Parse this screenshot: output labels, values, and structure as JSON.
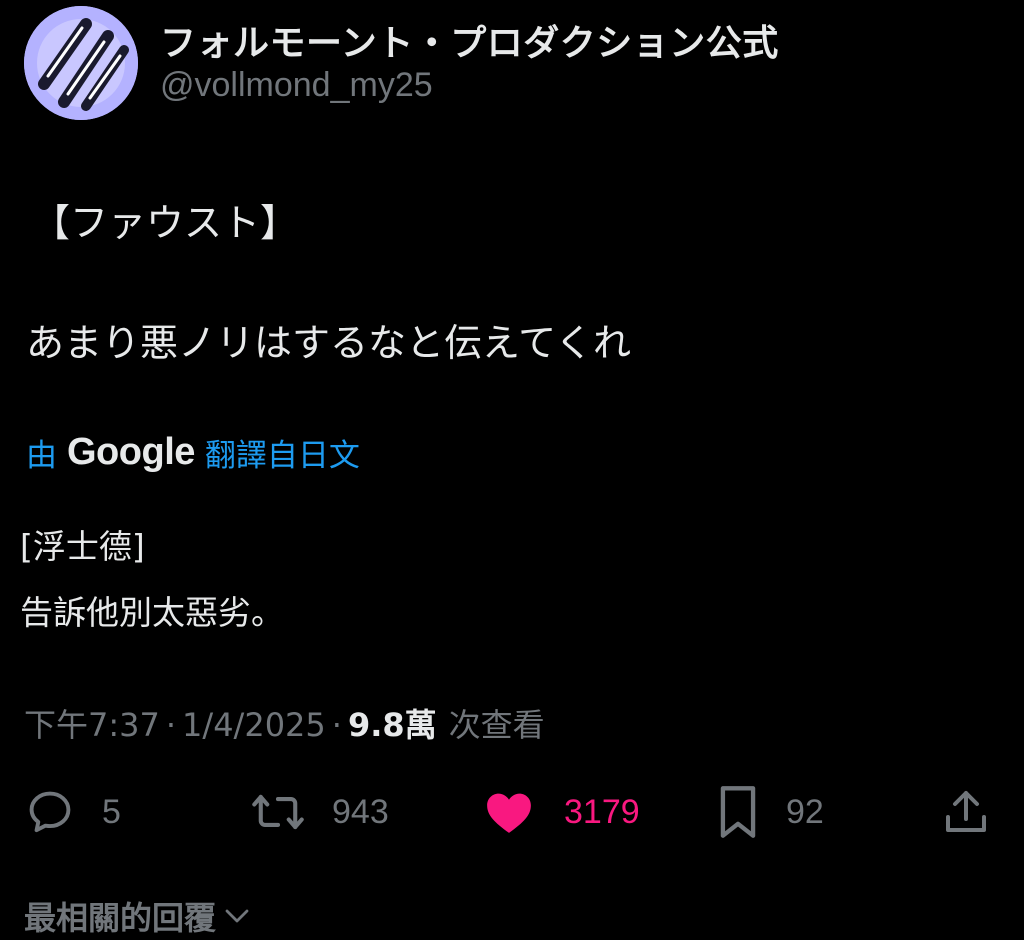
{
  "author": {
    "display_name": "フォルモーント・プロダクション公式",
    "handle": "@vollmond_my25",
    "avatar_bg": "#b4b2ff"
  },
  "tweet": {
    "lines": [
      "【ファウスト】",
      "あまり悪ノリはするなと伝えてくれ"
    ]
  },
  "translation": {
    "prefix": "由",
    "provider": "Google",
    "suffix": "翻譯自日文",
    "link_color": "#1d9bf0",
    "lines": [
      "[浮士德]",
      "告訴他別太惡劣。"
    ]
  },
  "meta": {
    "time": "下午7:37",
    "separator": "·",
    "date": "1/4/2025",
    "views_count": "9.8萬",
    "views_label": "次查看"
  },
  "actions": {
    "reply": {
      "icon": "reply-icon",
      "count": "5"
    },
    "repost": {
      "icon": "repost-icon",
      "count": "943"
    },
    "like": {
      "icon": "heart-icon",
      "count": "3179",
      "liked": true,
      "color": "#f91880"
    },
    "bookmark": {
      "icon": "bookmark-icon",
      "count": "92"
    },
    "share": {
      "icon": "share-icon"
    }
  },
  "replies": {
    "sort_label": "最相關的回覆",
    "icon": "chevron-down-icon"
  }
}
